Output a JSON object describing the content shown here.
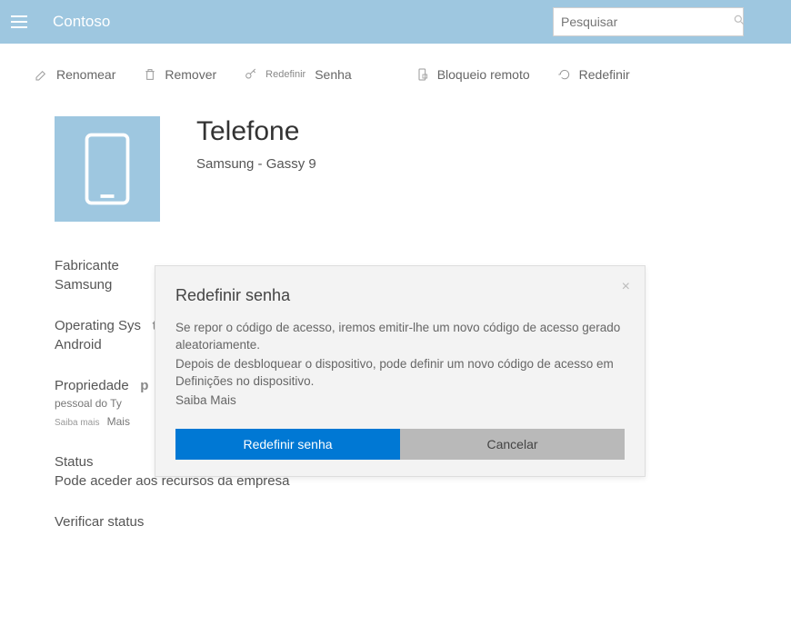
{
  "header": {
    "brand": "Contoso",
    "search_placeholder": "Pesquisar"
  },
  "toolbar": {
    "rename": "Renomear",
    "remove": "Remover",
    "reset_prefix": "Redefinir",
    "reset_suffix": "Senha",
    "remote_lock": "Bloqueio remoto",
    "reset": "Redefinir"
  },
  "device": {
    "title": "Telefone",
    "subtitle": "Samsung - Gassy 9"
  },
  "details": {
    "manufacturer_label": "Fabricante",
    "manufacturer_value": "Samsung",
    "os_label": "Operating Sys",
    "os_t": "t",
    "os_value": "Android",
    "ownership_label": "Propriedade",
    "ownership_p": "p",
    "ownership_value": "pessoal do Ty",
    "ownership_more_prefix": "Saiba mais",
    "ownership_more": "Mais",
    "status_label": "Status",
    "status_value": "Pode aceder aos recursos da empresa",
    "verify": "Verificar status"
  },
  "dialog": {
    "title": "Redefinir senha",
    "line1": "Se repor o código de acesso, iremos emitir-lhe um novo código de acesso gerado aleatoriamente.",
    "line2": "Depois de desbloquear o dispositivo, pode definir um novo código de acesso em Definições no dispositivo.",
    "learn_more": "Saiba Mais",
    "primary": "Redefinir senha",
    "secondary": "Cancelar"
  }
}
